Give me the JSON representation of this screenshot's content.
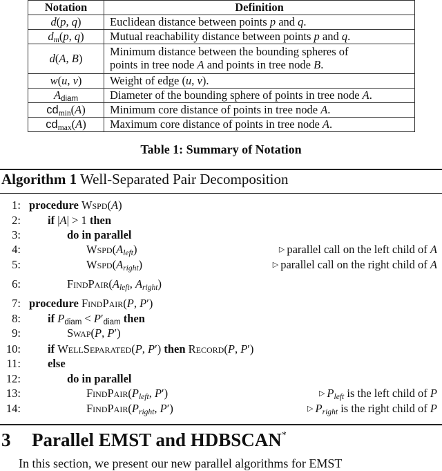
{
  "table": {
    "headers": [
      "Notation",
      "Definition"
    ],
    "rows": [
      {
        "sym": "d(p, q)",
        "def": "Euclidean distance between points p and q."
      },
      {
        "sym": "d_m(p, q)",
        "def": "Mutual reachability distance between points p and q."
      },
      {
        "sym": "d(A, B)",
        "def": "Minimum distance between the bounding spheres of points in tree node A and points in tree node B."
      },
      {
        "sym": "w(u, v)",
        "def": "Weight of edge (u, v)."
      },
      {
        "sym": "A_diam",
        "def": "Diameter of the bounding sphere of points in tree node A."
      },
      {
        "sym": "cd_min(A)",
        "def": "Minimum core distance of points in tree node A."
      },
      {
        "sym": "cd_max(A)",
        "def": "Maximum core distance of points in tree node A."
      }
    ],
    "caption": "Table 1: Summary of Notation"
  },
  "algorithm": {
    "label": "Algorithm 1",
    "title": "Well-Separated Pair Decomposition",
    "lines": [
      {
        "num": "1:",
        "text": "procedure WSPD(A)",
        "comment": ""
      },
      {
        "num": "2:",
        "text": "if |A| > 1 then",
        "comment": ""
      },
      {
        "num": "3:",
        "text": "do in parallel",
        "comment": ""
      },
      {
        "num": "4:",
        "text": "WSPD(A_left)",
        "comment": "parallel call on the left child of A"
      },
      {
        "num": "5:",
        "text": "WSPD(A_right)",
        "comment": "parallel call on the right child of A"
      },
      {
        "num": "6:",
        "text": "FindPair(A_left, A_right)",
        "comment": ""
      },
      {
        "num": "7:",
        "text": "procedure FindPair(P, P′)",
        "comment": ""
      },
      {
        "num": "8:",
        "text": "if P_diam < P′_diam then",
        "comment": ""
      },
      {
        "num": "9:",
        "text": "Swap(P, P′)",
        "comment": ""
      },
      {
        "num": "10:",
        "text": "if WellSeparated(P, P′) then Record(P, P′)",
        "comment": ""
      },
      {
        "num": "11:",
        "text": "else",
        "comment": ""
      },
      {
        "num": "12:",
        "text": "do in parallel",
        "comment": ""
      },
      {
        "num": "13:",
        "text": "FindPair(P_left, P′)",
        "comment": "P_left is the left child of P"
      },
      {
        "num": "14:",
        "text": "FindPair(P_right, P′)",
        "comment": "P_right is the right child of P"
      }
    ],
    "keywords": {
      "procedure": "procedure",
      "if": "if",
      "then": "then",
      "do_in_parallel": "do in parallel",
      "else": "else"
    },
    "names": {
      "wspd": "Wspd",
      "findpair": "FindPair",
      "swap": "Swap",
      "wellseparated": "WellSeparated",
      "record": "Record"
    },
    "comment_texts": {
      "c4": "parallel call on the left child of",
      "c5": "parallel call on the right child of",
      "c13": "is the left child of",
      "c14": "is the right child of"
    },
    "comment_icon": "triangle-right-icon"
  },
  "section": {
    "number": "3",
    "title": "Parallel EMST and HDBSCAN",
    "title_sup": "*",
    "body_start": "In this section, we present our new parallel algorithms for EMST"
  }
}
